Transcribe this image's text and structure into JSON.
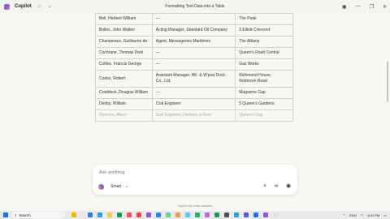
{
  "titlebar": {
    "app_name": "Copilot",
    "window_title": "Formatting Text Data into a Table"
  },
  "table": {
    "rows": [
      [
        "Bell, Herbert William",
        "—",
        "The Peak"
      ],
      [
        "Bolles, John Walker",
        "Acting Manager, Standard Oil Company",
        "3 Elliott Crescent"
      ],
      [
        "Champeaux, Guillaume de",
        "Agent, Messageries Maritimes",
        "The Albany"
      ],
      [
        "Cochrane, Thomas Park",
        "—",
        "Queen's Road Central"
      ],
      [
        "Collins, Francis George",
        "—",
        "Gas Works"
      ],
      [
        "Cooke, Robert",
        "Assistant Manager, HK. & W'poa Dock Co., Ltd.",
        "Richmond House, Robinson Road"
      ],
      [
        "Craddock, Douglas William",
        "—",
        "Magazine Gap"
      ],
      [
        "Denby, William",
        "Civil Engineer",
        "5 Queen's Gardens"
      ],
      [
        "Denison, Albert",
        "Civil Engineer, Denison & Ram",
        "Queen's Gap"
      ]
    ]
  },
  "composer": {
    "placeholder": "Ask anything",
    "mode_label": "Smart"
  },
  "disclaimer": "Copilot may make mistakes",
  "taskbar": {
    "search_label": "Search",
    "language": "ENG",
    "time": "6:41 PM"
  },
  "icons": [
    "copilot-logo",
    "home-icon",
    "chevron-down-icon",
    "sidebar-icon",
    "minimize-icon",
    "restore-icon",
    "close-icon",
    "plus-icon",
    "glasses-icon",
    "microphone-icon",
    "windows-start-icon",
    "search-icon"
  ]
}
